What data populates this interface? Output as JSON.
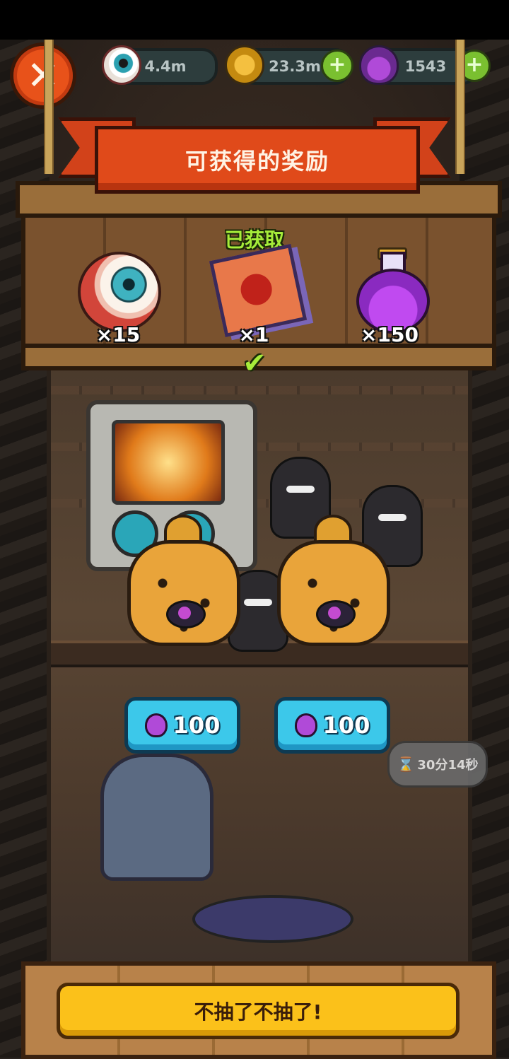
{
  "currency": {
    "eyes": "4.4m",
    "coins": "23.3m",
    "potions": "1543"
  },
  "rewards_panel": {
    "title": "可获得的奖励",
    "obtained_label": "已获取",
    "items": [
      {
        "icon": "eyeball-icon",
        "quantity": "×15"
      },
      {
        "icon": "scroll-icon",
        "quantity": "×1",
        "obtained": true
      },
      {
        "icon": "potion-icon",
        "quantity": "×150"
      }
    ]
  },
  "draw_buttons": [
    {
      "price": "100",
      "currency_icon": "potion-icon"
    },
    {
      "price": "100",
      "currency_icon": "potion-icon"
    }
  ],
  "timer": {
    "text": "30分14秒"
  },
  "quit_button": {
    "label": "不抽了不抽了!"
  },
  "colors": {
    "banner": "#e04a1a",
    "obtained_text": "#a6ec3a",
    "draw_button": "#3cc8ea",
    "quit_button": "#fbc11a"
  }
}
